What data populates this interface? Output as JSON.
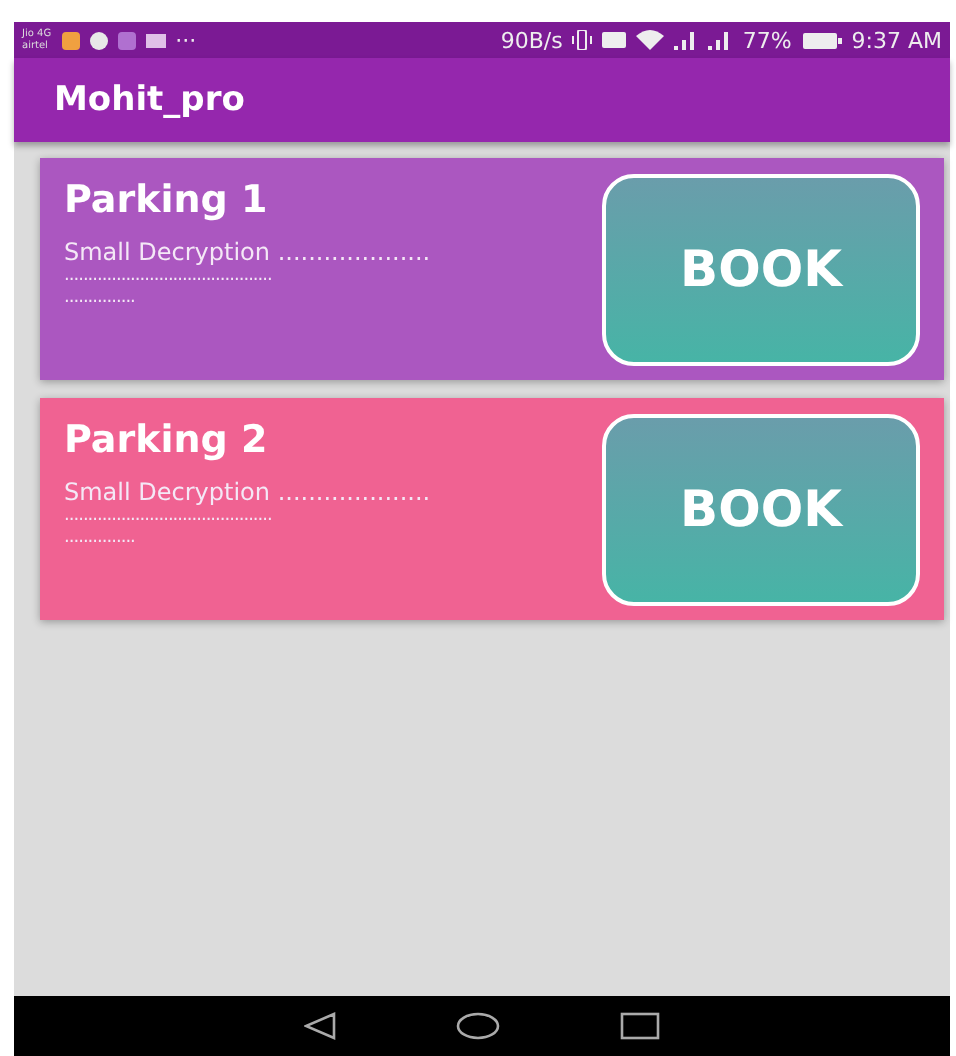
{
  "status_bar": {
    "carrier_top": "Jio 4G",
    "carrier_bottom": "airtel",
    "more": "···",
    "speed": "90B/s",
    "battery": "77%",
    "time": "9:37 AM"
  },
  "app_bar": {
    "title": "Mohit_pro"
  },
  "cards": [
    {
      "title": "Parking 1",
      "description": [
        "Small Decryption ....................",
        "............................................",
        "..............."
      ],
      "button": "BOOK",
      "color": "#ab57c0"
    },
    {
      "title": "Parking 2",
      "description": [
        "Small Decryption ....................",
        "............................................",
        "..............."
      ],
      "button": "BOOK",
      "color": "#f06292"
    }
  ]
}
